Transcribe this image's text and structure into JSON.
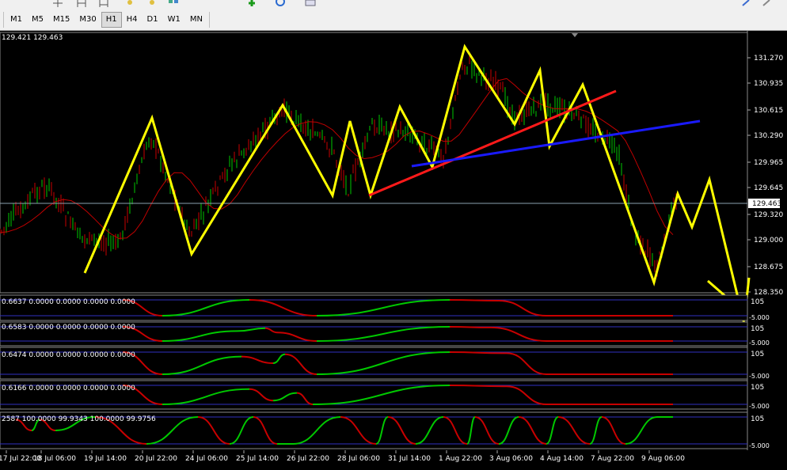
{
  "toolbar": {
    "timeframes": [
      {
        "label": "M1"
      },
      {
        "label": "M5"
      },
      {
        "label": "M15"
      },
      {
        "label": "M30"
      },
      {
        "label": "H1",
        "active": true
      },
      {
        "label": "H4"
      },
      {
        "label": "D1"
      },
      {
        "label": "W1"
      },
      {
        "label": "MN"
      }
    ]
  },
  "chart": {
    "header_values": "129.421 129.463",
    "current_price": "129.463",
    "price_ticks": [
      "131.270",
      "130.935",
      "130.615",
      "130.290",
      "129.965",
      "129.645",
      "129.320",
      "129.000",
      "128.675",
      "128.350"
    ],
    "time_labels": [
      "17 Jul 22:00",
      "18 Jul 06:00",
      "19 Jul 14:00",
      "20 Jul 22:00",
      "24 Jul 06:00",
      "25 Jul 14:00",
      "26 Jul 22:00",
      "28 Jul 06:00",
      "31 Jul 14:00",
      "1 Aug 22:00",
      "3 Aug 06:00",
      "4 Aug 14:00",
      "7 Aug 22:00",
      "9 Aug 06:00"
    ],
    "indicators": [
      {
        "label": "0.6637 0.0000 0.0000 0.0000 0.0000",
        "scale_top": "105",
        "scale_bottom": "-5.000"
      },
      {
        "label": "0.6583 0.0000 0.0000 0.0000 0.0000",
        "scale_top": "105",
        "scale_bottom": "-5.000"
      },
      {
        "label": "0.6474 0.0000 0.0000 0.0000 0.0000",
        "scale_top": "105",
        "scale_bottom": "-5.000"
      },
      {
        "label": "0.6166 0.0000 0.0000 0.0000 0.0000",
        "scale_top": "105",
        "scale_bottom": "-5.000"
      },
      {
        "label": "2587 100.0000 99.9343 100.0000 99.9756",
        "scale_top": "105",
        "scale_bottom": "-5.000"
      }
    ],
    "colors": {
      "zigzag": "#ffff00",
      "trend_red": "#ff1a1a",
      "trend_blue": "#1a1aff",
      "ma": "#c00000",
      "bull": "#00c800",
      "bear": "#c80000",
      "price_line": "#8aa0b0"
    }
  }
}
